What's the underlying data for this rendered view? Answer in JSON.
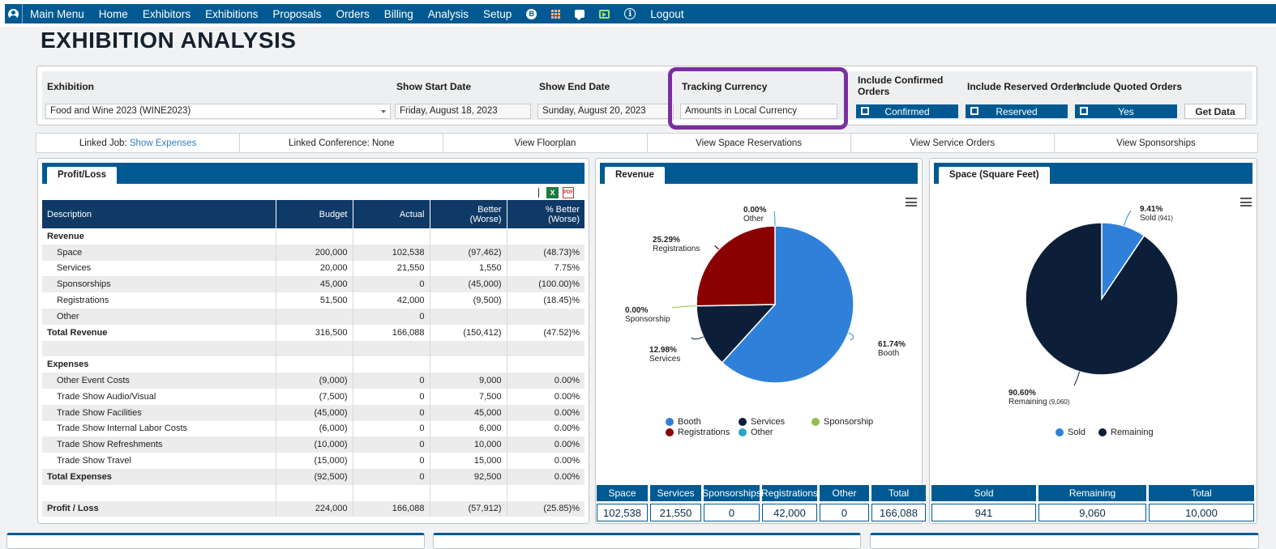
{
  "nav": {
    "items": [
      "Main Menu",
      "Home",
      "Exhibitors",
      "Exhibitions",
      "Proposals",
      "Orders",
      "Billing",
      "Analysis",
      "Setup"
    ],
    "badge": "B",
    "info": "i",
    "logout": "Logout",
    "icons": [
      "user-icon",
      "b-badge-icon",
      "grid-icon",
      "chat-icon",
      "tv-icon",
      "info-icon"
    ]
  },
  "page": {
    "title": "EXHIBITION ANALYSIS"
  },
  "filters": {
    "exhibition_label": "Exhibition",
    "exhibition_value": "Food and Wine 2023 (WINE2023)",
    "start_label": "Show Start Date",
    "start_value": "Friday, August 18, 2023",
    "end_label": "Show End Date",
    "end_value": "Sunday, August 20, 2023",
    "currency_label": "Tracking Currency",
    "currency_value": "Amounts in Local Currency",
    "confirmed_label": "Include Confirmed Orders",
    "confirmed_value": "Confirmed",
    "reserved_label": "Include Reserved Orders",
    "reserved_value": "Reserved",
    "quoted_label": "Include Quoted Orders",
    "quoted_value": "Yes",
    "get_data": "Get Data"
  },
  "links": {
    "linked_job_label": "Linked Job:",
    "linked_job_link": "Show Expenses",
    "linked_conf": "Linked Conference: None",
    "floorplan": "View Floorplan",
    "space_res": "View Space Reservations",
    "service_orders": "View Service Orders",
    "sponsorships": "View Sponsorships"
  },
  "profit_loss": {
    "tab": "Profit/Loss",
    "excel_glyph": "X",
    "pdf_glyph": "PDF",
    "headers": [
      "Description",
      "Budget",
      "Actual",
      "Better (Worse)",
      "% Better (Worse)"
    ],
    "rows": [
      {
        "desc": "Revenue",
        "budget": "",
        "actual": "",
        "better": "",
        "pct": ""
      },
      {
        "desc": "Space",
        "budget": "200,000",
        "actual": "102,538",
        "better": "(97,462)",
        "pct": "(48.73)%"
      },
      {
        "desc": "Services",
        "budget": "20,000",
        "actual": "21,550",
        "better": "1,550",
        "pct": "7.75%"
      },
      {
        "desc": "Sponsorships",
        "budget": "45,000",
        "actual": "0",
        "better": "(45,000)",
        "pct": "(100.00)%"
      },
      {
        "desc": "Registrations",
        "budget": "51,500",
        "actual": "42,000",
        "better": "(9,500)",
        "pct": "(18.45)%"
      },
      {
        "desc": "Other",
        "budget": "",
        "actual": "0",
        "better": "",
        "pct": ""
      },
      {
        "desc": "Total Revenue",
        "budget": "316,500",
        "actual": "166,088",
        "better": "(150,412)",
        "pct": "(47.52)%"
      },
      {
        "desc": "",
        "budget": "",
        "actual": "",
        "better": "",
        "pct": ""
      },
      {
        "desc": "Expenses",
        "budget": "",
        "actual": "",
        "better": "",
        "pct": ""
      },
      {
        "desc": "Other Event Costs",
        "budget": "(9,000)",
        "actual": "0",
        "better": "9,000",
        "pct": "0.00%"
      },
      {
        "desc": "Trade Show Audio/Visual",
        "budget": "(7,500)",
        "actual": "0",
        "better": "7,500",
        "pct": "0.00%"
      },
      {
        "desc": "Trade Show Facilities",
        "budget": "(45,000)",
        "actual": "0",
        "better": "45,000",
        "pct": "0.00%"
      },
      {
        "desc": "Trade Show Internal Labor Costs",
        "budget": "(6,000)",
        "actual": "0",
        "better": "6,000",
        "pct": "0.00%"
      },
      {
        "desc": "Trade Show Refreshments",
        "budget": "(10,000)",
        "actual": "0",
        "better": "10,000",
        "pct": "0.00%"
      },
      {
        "desc": "Trade Show Travel",
        "budget": "(15,000)",
        "actual": "0",
        "better": "15,000",
        "pct": "0.00%"
      },
      {
        "desc": "Total Expenses",
        "budget": "(92,500)",
        "actual": "0",
        "better": "92,500",
        "pct": "0.00%"
      },
      {
        "desc": "",
        "budget": "",
        "actual": "",
        "better": "",
        "pct": ""
      },
      {
        "desc": "Profit / Loss",
        "budget": "224,000",
        "actual": "166,088",
        "better": "(57,912)",
        "pct": "(25.85)%"
      }
    ]
  },
  "revenue": {
    "tab": "Revenue",
    "summary": [
      {
        "label": "Space",
        "value": "102,538"
      },
      {
        "label": "Services",
        "value": "21,550"
      },
      {
        "label": "Sponsorships",
        "value": "0"
      },
      {
        "label": "Registrations",
        "value": "42,000"
      },
      {
        "label": "Other",
        "value": "0"
      },
      {
        "label": "Total",
        "value": "166,088"
      }
    ]
  },
  "space": {
    "tab": "Space (Square Feet)",
    "summary": [
      {
        "label": "Sold",
        "value": "941"
      },
      {
        "label": "Remaining",
        "value": "9,060"
      },
      {
        "label": "Total",
        "value": "10,000"
      }
    ]
  },
  "chart_data": [
    {
      "type": "pie",
      "slices": [
        {
          "name": "Booth",
          "value": 61.74,
          "pct_label": "61.74%",
          "color": "#2f80d8"
        },
        {
          "name": "Services",
          "value": 12.98,
          "pct_label": "12.98%",
          "color": "#0d1f38"
        },
        {
          "name": "Sponsorship",
          "value": 0,
          "pct_label": "0.00%",
          "color": "#8bc34a"
        },
        {
          "name": "Registrations",
          "value": 25.29,
          "pct_label": "25.29%",
          "color": "#8b0000"
        },
        {
          "name": "Other",
          "value": 0,
          "pct_label": "0.00%",
          "color": "#22a9c9"
        }
      ]
    },
    {
      "type": "pie",
      "slices": [
        {
          "name": "Sold",
          "value": 9.41,
          "pct_label": "9.41%",
          "extra": "(941)",
          "color": "#2f80d8"
        },
        {
          "name": "Remaining",
          "value": 90.6,
          "pct_label": "90.60%",
          "extra": "(9,060)",
          "color": "#0d1f38"
        }
      ]
    }
  ]
}
